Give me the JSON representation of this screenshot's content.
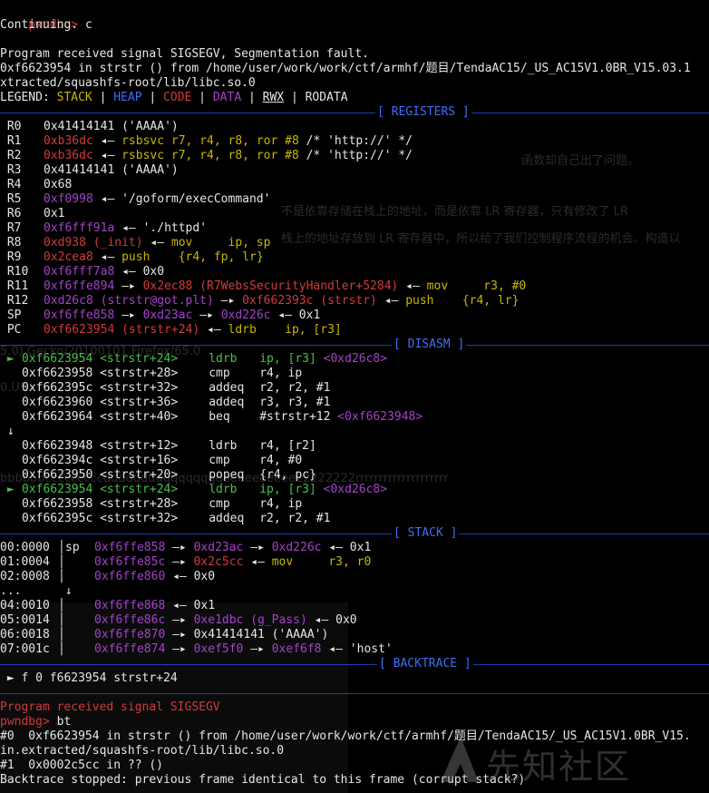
{
  "terminal": {
    "prompt": "pwndbg>",
    "cmd_continue": "c",
    "continuing": "Continuing.",
    "signal_line": "Program received signal SIGSEGV, Segmentation fault.",
    "fault_line": "0xf6623954 in strstr () from /home/user/work/work/ctf/armhf/题目/TendaAC15/_US_AC15V1.0BR_V15.03.1",
    "fault_line2": "xtracted/squashfs-root/lib/libc.so.0",
    "legend": {
      "label": "LEGEND:",
      "stack": "STACK",
      "heap": "HEAP",
      "code": "CODE",
      "data": "DATA",
      "rwx": "RWX",
      "rodata": "RODATA",
      "sep": " | "
    }
  },
  "sections": {
    "registers": "[ REGISTERS ]",
    "disasm": "[ DISASM ]",
    "stack": "[ STACK ]",
    "backtrace": "[ BACKTRACE ]"
  },
  "registers": [
    {
      "name": "R0",
      "a": "0x41414141",
      "ac": "wht",
      "rest": " ('AAAA')"
    },
    {
      "name": "R1",
      "a": "0xb36dc",
      "ac": "red",
      "arrow": " ◂— ",
      "ins": "rsbsvc r7, r4, r8, ror #8",
      "tail": " /* 'http://' */"
    },
    {
      "name": "R2",
      "a": "0xb36dc",
      "ac": "red",
      "arrow": " ◂— ",
      "ins": "rsbsvc r7, r4, r8, ror #8",
      "tail": " /* 'http://' */"
    },
    {
      "name": "R3",
      "a": "0x41414141",
      "ac": "wht",
      "rest": " ('AAAA')"
    },
    {
      "name": "R4",
      "a": "0x68",
      "ac": "wht",
      "rest": ""
    },
    {
      "name": "R5",
      "a": "0xf0998",
      "ac": "mag",
      "rest": " ◂— '/goform/execCommand'"
    },
    {
      "name": "R6",
      "a": "0x1",
      "ac": "wht",
      "rest": ""
    },
    {
      "name": "R7",
      "a": "0xf6fff91a",
      "ac": "mag",
      "rest": " ◂— './httpd'"
    },
    {
      "name": "R8",
      "a": "0xd938 (_init)",
      "ac": "red",
      "arrow": " ◂— ",
      "ins": "mov     ip, sp",
      "tail": ""
    },
    {
      "name": "R9",
      "a": "0x2cea8",
      "ac": "red",
      "arrow": " ◂— ",
      "ins": "push    {r4, fp, lr}",
      "tail": ""
    },
    {
      "name": "R10",
      "a": "0xf6fff7a8",
      "ac": "mag",
      "rest": " ◂— 0x0"
    },
    {
      "name": "R11",
      "a": "0xf6ffe894",
      "ac": "mag",
      "arrow": " —▸ ",
      "b": "0x2ec88 (R7WebsSecurityHandler+5284)",
      "bc": "red",
      "arrow2": " ◂— ",
      "ins": "mov     r3, #0",
      "tail": ""
    },
    {
      "name": "R12",
      "a": "0xd26c8 (strstr@got.plt)",
      "ac": "mag",
      "arrow": " —▸ ",
      "b": "0xf662393c (strstr)",
      "bc": "red",
      "arrow2": " ◂— ",
      "ins": "push    {r4, lr}",
      "tail": ""
    },
    {
      "name": "SP",
      "a": "0xf6ffe858",
      "ac": "mag",
      "arrow": " —▸ ",
      "b": "0xd23ac",
      "bc": "mag",
      "arrow2": " —▸ ",
      "c": "0xd226c",
      "cc": "mag",
      "tail2": " ◂— 0x1"
    },
    {
      "name": "PC",
      "a": "0xf6623954 (strstr+24)",
      "ac": "red",
      "arrow": " ◂— ",
      "ins": "ldrb    ip, [r3]",
      "tail": ""
    }
  ],
  "disasm": [
    {
      "mark": "►",
      "addr": "0xf6623954",
      "sym": "<strstr+24>",
      "op": "ldrb",
      "args": "ip, [r3]",
      "extra": " <0xd26c8>",
      "cur": true
    },
    {
      "mark": "",
      "addr": "0xf6623958",
      "sym": "<strstr+28>",
      "op": "cmp",
      "args": "r4, ip"
    },
    {
      "mark": "",
      "addr": "0xf662395c",
      "sym": "<strstr+32>",
      "op": "addeq",
      "args": "r2, r2, #1"
    },
    {
      "mark": "",
      "addr": "0xf6623960",
      "sym": "<strstr+36>",
      "op": "addeq",
      "args": "r3, r3, #1"
    },
    {
      "mark": "",
      "addr": "0xf6623964",
      "sym": "<strstr+40>",
      "op": "beq",
      "args": "#strstr+12",
      "extra": " <0xf6623948>"
    },
    {
      "mark": "↓",
      "addr": "",
      "sym": "",
      "op": "",
      "args": ""
    },
    {
      "mark": "",
      "addr": "0xf6623948",
      "sym": "<strstr+12>",
      "op": "ldrb",
      "args": "r4, [r2]"
    },
    {
      "mark": "",
      "addr": "0xf662394c",
      "sym": "<strstr+16>",
      "op": "cmp",
      "args": "r4, #0"
    },
    {
      "mark": "",
      "addr": "0xf6623950",
      "sym": "<strstr+20>",
      "op": "popeq",
      "args": "{r4, pc}"
    },
    {
      "mark": "►",
      "addr": "0xf6623954",
      "sym": "<strstr+24>",
      "op": "ldrb",
      "args": "ip, [r3]",
      "extra": " <0xd26c8>",
      "cur": true
    },
    {
      "mark": "",
      "addr": "0xf6623958",
      "sym": "<strstr+28>",
      "op": "cmp",
      "args": "r4, ip"
    },
    {
      "mark": "",
      "addr": "0xf662395c",
      "sym": "<strstr+32>",
      "op": "addeq",
      "args": "r2, r2, #1"
    }
  ],
  "stack": [
    {
      "idx": "00:0000",
      "reg": "sp",
      "addr": "0xf6ffe858",
      "chain": [
        {
          "t": " —▸ ",
          "c": "wht"
        },
        {
          "t": "0xd23ac",
          "c": "mag"
        },
        {
          "t": " —▸ ",
          "c": "wht"
        },
        {
          "t": "0xd226c",
          "c": "mag"
        },
        {
          "t": " ◂— 0x1",
          "c": "wht"
        }
      ]
    },
    {
      "idx": "01:0004",
      "reg": "",
      "addr": "0xf6ffe85c",
      "chain": [
        {
          "t": " —▸ ",
          "c": "wht"
        },
        {
          "t": "0x2c5cc",
          "c": "red"
        },
        {
          "t": " ◂— ",
          "c": "wht"
        },
        {
          "t": "mov     r3, r0",
          "c": "yel"
        }
      ]
    },
    {
      "idx": "02:0008",
      "reg": "",
      "addr": "0xf6ffe860",
      "chain": [
        {
          "t": " ◂— 0x0",
          "c": "wht"
        }
      ]
    },
    {
      "idx": "...",
      "reg": "",
      "addr": "",
      "chain": [
        {
          "t": " ↓",
          "c": "wht"
        }
      ]
    },
    {
      "idx": "04:0010",
      "reg": "",
      "addr": "0xf6ffe868",
      "chain": [
        {
          "t": " ◂— 0x1",
          "c": "wht"
        }
      ]
    },
    {
      "idx": "05:0014",
      "reg": "",
      "addr": "0xf6ffe86c",
      "chain": [
        {
          "t": " —▸ ",
          "c": "wht"
        },
        {
          "t": "0xe1dbc (g_Pass)",
          "c": "mag"
        },
        {
          "t": " ◂— 0x0",
          "c": "wht"
        }
      ]
    },
    {
      "idx": "06:0018",
      "reg": "",
      "addr": "0xf6ffe870",
      "chain": [
        {
          "t": " —▸ 0x41414141 ('AAAA')",
          "c": "wht"
        }
      ]
    },
    {
      "idx": "07:001c",
      "reg": "",
      "addr": "0xf6ffe874",
      "chain": [
        {
          "t": " —▸ ",
          "c": "wht"
        },
        {
          "t": "0xef5f0",
          "c": "mag"
        },
        {
          "t": " —▸ ",
          "c": "wht"
        },
        {
          "t": "0xef6f8",
          "c": "mag"
        },
        {
          "t": " ◂— 'host'",
          "c": "wht"
        }
      ]
    }
  ],
  "backtrace": {
    "frame": " ► f 0 f6623954 strstr+24"
  },
  "after": {
    "signal2": "Program received signal SIGSEGV",
    "bt_cmd": "bt",
    "bt0": "#0  0xf6623954 in strstr () from /home/user/work/work/ctf/armhf/题目/TendaAC15/_US_AC15V1.0BR_V15.",
    "bt0b": "in.extracted/squashfs-root/lib/libc.so.0",
    "bt1": "#1  0x0002c5cc in ?? ()",
    "bt_stop": "Backtrace stopped: previous frame identical to this frame (corrupt stack?)"
  },
  "ghost": {
    "g1": "函数却自己出了问题。",
    "g2": "不是依靠存储在栈上的地址，而是依靠 LR 寄存器，只有修改了 LR",
    "g3": "栈上的地址存放到 LR 寄存器中，所以给了我们控制程序流程的机会。构造以",
    "g4": "5.0) Gecko/20100101 Firefox/65.0",
    "g5": "bbbbbbcccccccccddddddddqqqqqqqqeeeeeeeeee22222222rrrrrrrrrrrrrrrrrrrr",
    "g6": "0.US"
  },
  "watermark": {
    "text": "先知社区"
  }
}
